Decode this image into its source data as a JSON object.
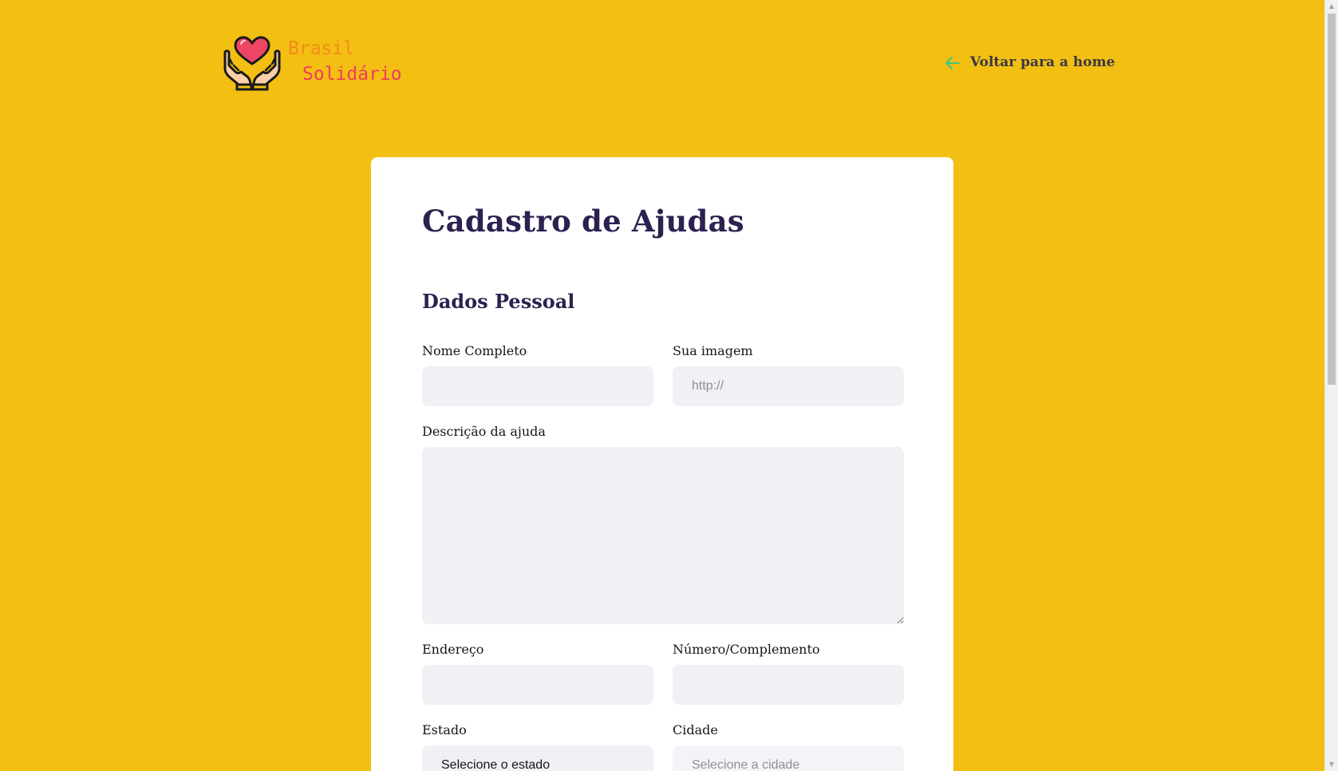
{
  "header": {
    "brand_line1": "Brasil",
    "brand_line2": "Solidário",
    "back_label": "Voltar para a home"
  },
  "form": {
    "title": "Cadastro de Ajudas",
    "section_title": "Dados Pessoal",
    "fields": {
      "name_label": "Nome Completo",
      "name_value": "",
      "image_label": "Sua imagem",
      "image_placeholder": "http://",
      "description_label": "Descrição da ajuda",
      "description_value": "",
      "address_label": "Endereço",
      "address_value": "",
      "number_label": "Número/Complemento",
      "number_value": "",
      "state_label": "Estado",
      "state_selected": "Selecione o estado",
      "city_label": "Cidade",
      "city_selected": "Selecione a cidade"
    }
  },
  "colors": {
    "background": "#f3bf12",
    "card": "#ffffff",
    "title": "#2d2150",
    "input_bg": "#f0f0f5",
    "brand_orange": "#f28c1c",
    "brand_red": "#ef3c5c",
    "back_arrow": "#37c77f"
  },
  "icons": {
    "logo": "heart-hands-icon",
    "back": "arrow-left-icon"
  }
}
